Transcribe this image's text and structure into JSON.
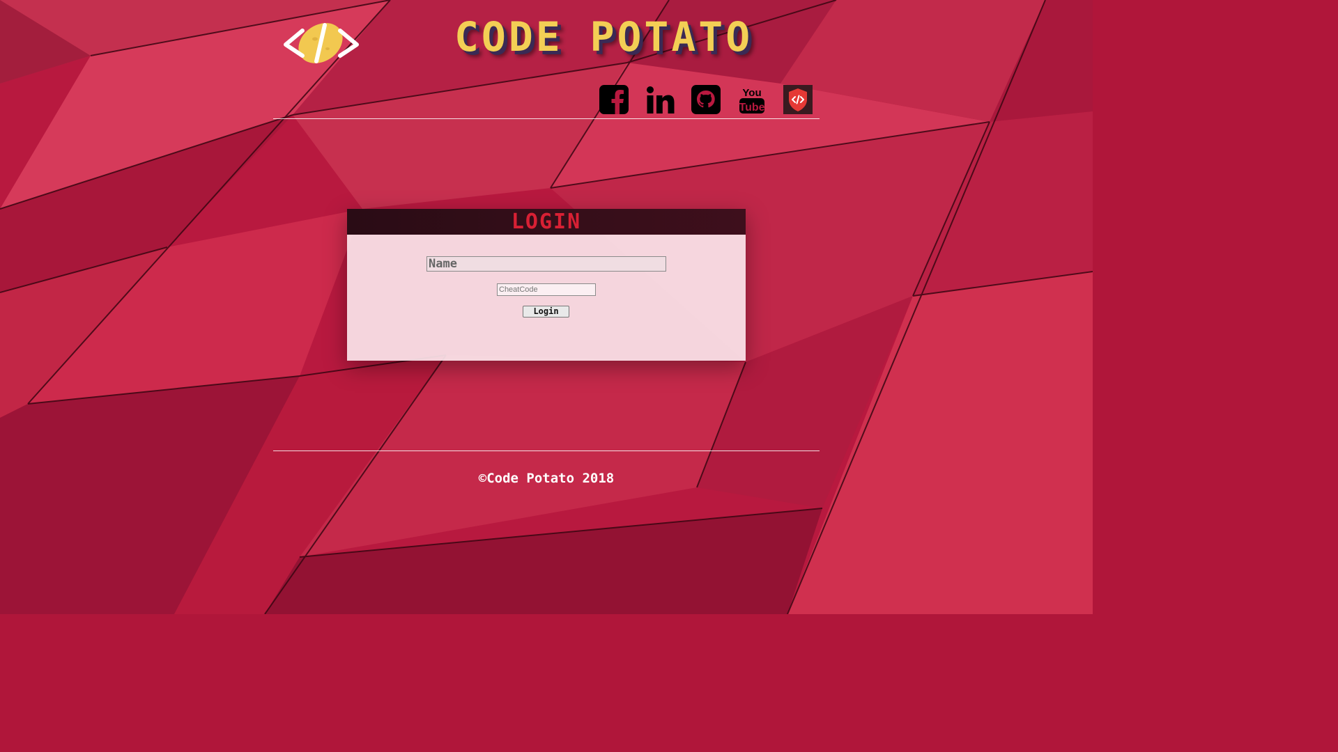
{
  "header": {
    "logo_icon": "code-potato-logo-icon",
    "site_title": "CODE POTATO",
    "title_color": "#f3cf55"
  },
  "social": [
    {
      "name": "facebook",
      "icon": "facebook-icon"
    },
    {
      "name": "linkedin",
      "icon": "linkedin-icon"
    },
    {
      "name": "github",
      "icon": "github-icon"
    },
    {
      "name": "youtube",
      "icon": "youtube-icon"
    },
    {
      "name": "code-shield",
      "icon": "code-shield-icon",
      "color": "#e53935"
    }
  ],
  "login": {
    "title": "LOGIN",
    "title_color": "#d82034",
    "name_placeholder": "Name",
    "name_value": "",
    "cheatcode_placeholder": "CheatCode",
    "cheatcode_value": "",
    "button_label": "Login"
  },
  "footer": {
    "copyright": "©Code Potato 2018"
  },
  "theme": {
    "background": "#b0163a",
    "accent": "#f3cf55"
  }
}
